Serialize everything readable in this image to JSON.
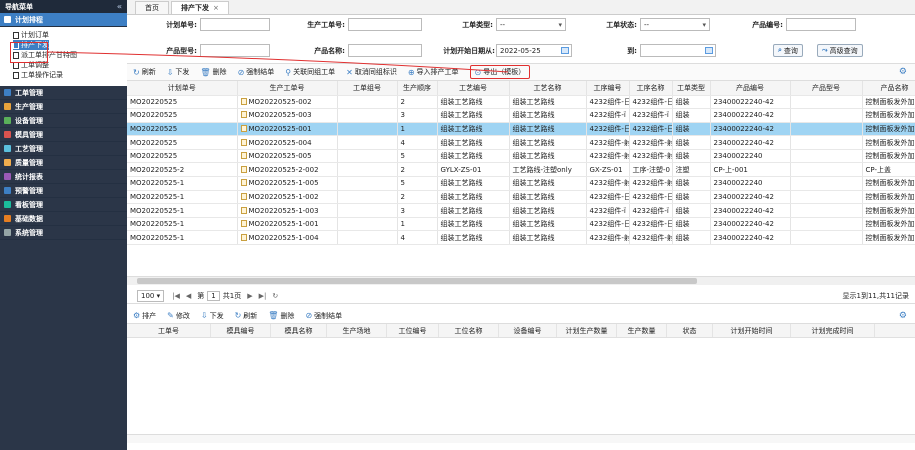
{
  "sidebar": {
    "title": "导航菜单",
    "collapse_icon": "«",
    "active_group": "计划排程",
    "sub_items": [
      "计划订单",
      "排产下发",
      "派工单排产甘特图",
      "工单调整",
      "工单操作记录"
    ],
    "groups": [
      "工单管理",
      "生产管理",
      "设备管理",
      "模具管理",
      "工艺管理",
      "质量管理",
      "统计报表",
      "预警管理",
      "看板管理",
      "基础数据",
      "系统管理"
    ]
  },
  "tabs": [
    {
      "label": "首页"
    },
    {
      "label": "排产下发",
      "close": "×"
    }
  ],
  "form": {
    "plan_no_label": "计划单号:",
    "work_order_label": "生产工单号:",
    "order_type_label": "工单类型:",
    "order_type_value": "--",
    "order_status_label": "工单状态:",
    "order_status_value": "--",
    "product_code_label": "产品编号:",
    "product_model_label": "产品型号:",
    "product_name_label": "产品名称:",
    "start_date_label": "计划开始日期从:",
    "start_date_value": "2022-05-25",
    "to_label": "到:",
    "query_label": "查询",
    "advanced_label": "高级查询"
  },
  "toolbar": {
    "refresh": "刷新",
    "issue": "下发",
    "delete": "删除",
    "force_close": "强制结单",
    "link_group": "关联同组工单",
    "cancel_group": "取消同组标识",
    "import": "导入排产工单",
    "export": "导出（模板）"
  },
  "table": {
    "headers": [
      "计划单号",
      "生产工单号",
      "工单组号",
      "生产顺序",
      "工艺编号",
      "工艺名称",
      "工序编号",
      "工序名称",
      "工单类型",
      "产品编号",
      "产品型号",
      "产品名称"
    ],
    "rows": [
      [
        "MO20220525",
        "MO20220525-002",
        "",
        "2",
        "组装工艺路线",
        "组装工艺路线",
        "4232组件-日",
        "4232组件-日",
        "组装",
        "23400022240-42",
        "",
        "控制面板发外加"
      ],
      [
        "MO20220525",
        "MO20220525-003",
        "",
        "3",
        "组装工艺路线",
        "组装工艺路线",
        "4232组件-ï",
        "4232组件-ï",
        "组装",
        "23400022240-42",
        "",
        "控制面板发外加"
      ],
      [
        "MO20220525",
        "MO20220525-001",
        "",
        "1",
        "组装工艺路线",
        "组装工艺路线",
        "4232组件-日",
        "4232组件-日",
        "组装",
        "23400022240-42",
        "",
        "控制面板发外加"
      ],
      [
        "MO20220525",
        "MO20220525-004",
        "",
        "4",
        "组装工艺路线",
        "组装工艺路线",
        "4232组件-射",
        "4232组件-射",
        "组装",
        "23400022240-42",
        "",
        "控制面板发外加"
      ],
      [
        "MO20220525",
        "MO20220525-005",
        "",
        "5",
        "组装工艺路线",
        "组装工艺路线",
        "4232组件-射",
        "4232组件-射",
        "组装",
        "23400022240",
        "",
        "控制面板发外加"
      ],
      [
        "MO20220525-2",
        "MO20220525-2-002",
        "",
        "2",
        "GYLX-ZS-01",
        "工艺路线-注塑only",
        "GX-ZS-01",
        "工序-注塑-0",
        "注塑",
        "CP-上-001",
        "",
        "CP-上盖"
      ],
      [
        "MO20220525-1",
        "MO20220525-1-005",
        "",
        "5",
        "组装工艺路线",
        "组装工艺路线",
        "4232组件-射",
        "4232组件-射",
        "组装",
        "23400022240",
        "",
        "控制面板发外加"
      ],
      [
        "MO20220525-1",
        "MO20220525-1-002",
        "",
        "2",
        "组装工艺路线",
        "组装工艺路线",
        "4232组件-日",
        "4232组件-日",
        "组装",
        "23400022240-42",
        "",
        "控制面板发外加"
      ],
      [
        "MO20220525-1",
        "MO20220525-1-003",
        "",
        "3",
        "组装工艺路线",
        "组装工艺路线",
        "4232组件-ï",
        "4232组件-ï",
        "组装",
        "23400022240-42",
        "",
        "控制面板发外加"
      ],
      [
        "MO20220525-1",
        "MO20220525-1-001",
        "",
        "1",
        "组装工艺路线",
        "组装工艺路线",
        "4232组件-日",
        "4232组件-日",
        "组装",
        "23400022240-42",
        "",
        "控制面板发外加"
      ],
      [
        "MO20220525-1",
        "MO20220525-1-004",
        "",
        "4",
        "组装工艺路线",
        "组装工艺路线",
        "4232组件-射",
        "4232组件-射",
        "组装",
        "23400022240-42",
        "",
        "控制面板发外加"
      ]
    ],
    "selected_row": 2
  },
  "pager": {
    "page_size": "100",
    "page_label": "第",
    "page_value": "1",
    "total_pages": "共1页",
    "info": "显示1到11,共11记录"
  },
  "toolbar2": {
    "schedule": "排产",
    "edit": "修改",
    "issue": "下发",
    "refresh": "刷新",
    "delete": "删除",
    "force_close": "强制结单"
  },
  "detail_headers": [
    "工单号",
    "模具编号",
    "模具名称",
    "生产场地",
    "工位编号",
    "工位名称",
    "设备编号",
    "计划生产数量",
    "生产数量",
    "状态",
    "计划开始时间",
    "计划完成时间"
  ],
  "colors": {
    "sidebar_bg": "#2b3648",
    "active_blue": "#3d7fc4",
    "selected_row": "#9fd4f3",
    "highlight_red": "#e03030"
  }
}
